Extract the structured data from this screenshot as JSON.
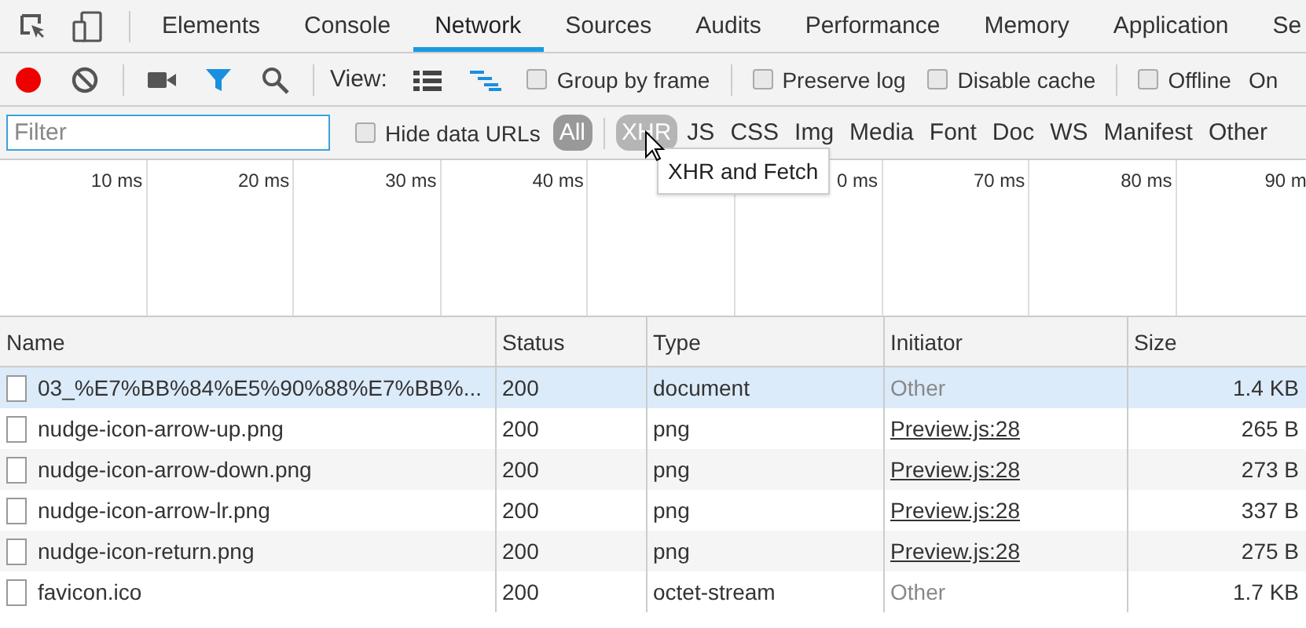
{
  "tabs": [
    {
      "label": "Elements",
      "selected": false
    },
    {
      "label": "Console",
      "selected": false
    },
    {
      "label": "Network",
      "selected": true
    },
    {
      "label": "Sources",
      "selected": false
    },
    {
      "label": "Audits",
      "selected": false
    },
    {
      "label": "Performance",
      "selected": false
    },
    {
      "label": "Memory",
      "selected": false
    },
    {
      "label": "Application",
      "selected": false
    },
    {
      "label": "Se",
      "selected": false
    }
  ],
  "toolbar": {
    "recording": true,
    "filter_active": true,
    "view_label": "View:",
    "checkboxes": [
      {
        "label": "Group by frame",
        "checked": false
      },
      {
        "label": "Preserve log",
        "checked": false
      },
      {
        "label": "Disable cache",
        "checked": false
      },
      {
        "label": "Offline",
        "checked": false
      }
    ],
    "trailing_text": "On"
  },
  "filter_bar": {
    "placeholder": "Filter",
    "hide_data_urls": {
      "label": "Hide data URLs",
      "checked": false
    },
    "types": [
      {
        "label": "All",
        "selected": true,
        "hovered": false
      },
      {
        "label": "XHR",
        "selected": false,
        "hovered": true
      },
      {
        "label": "JS",
        "selected": false,
        "hovered": false
      },
      {
        "label": "CSS",
        "selected": false,
        "hovered": false
      },
      {
        "label": "Img",
        "selected": false,
        "hovered": false
      },
      {
        "label": "Media",
        "selected": false,
        "hovered": false
      },
      {
        "label": "Font",
        "selected": false,
        "hovered": false
      },
      {
        "label": "Doc",
        "selected": false,
        "hovered": false
      },
      {
        "label": "WS",
        "selected": false,
        "hovered": false
      },
      {
        "label": "Manifest",
        "selected": false,
        "hovered": false
      },
      {
        "label": "Other",
        "selected": false,
        "hovered": false
      }
    ]
  },
  "tooltip": "XHR and Fetch",
  "overview": {
    "columns": [
      {
        "tick": "10 ms"
      },
      {
        "tick": "20 ms"
      },
      {
        "tick": "30 ms"
      },
      {
        "tick": "40 ms"
      },
      {},
      {
        "tick": "0 ms"
      },
      {
        "tick": "70 ms"
      },
      {
        "tick": "80 ms"
      },
      {
        "tick": "90 m"
      }
    ]
  },
  "table": {
    "columns": [
      "Name",
      "Status",
      "Type",
      "Initiator",
      "Size"
    ],
    "rows": [
      {
        "name": "03_%E7%BB%84%E5%90%88%E7%BB%...",
        "status": "200",
        "type": "document",
        "initiator": {
          "label": "Other",
          "kind": "text"
        },
        "size": "1.4 KB",
        "selected": true
      },
      {
        "name": "nudge-icon-arrow-up.png",
        "status": "200",
        "type": "png",
        "initiator": {
          "label": "Preview.js:28",
          "kind": "link"
        },
        "size": "265 B",
        "selected": false
      },
      {
        "name": "nudge-icon-arrow-down.png",
        "status": "200",
        "type": "png",
        "initiator": {
          "label": "Preview.js:28",
          "kind": "link"
        },
        "size": "273 B",
        "selected": false
      },
      {
        "name": "nudge-icon-arrow-lr.png",
        "status": "200",
        "type": "png",
        "initiator": {
          "label": "Preview.js:28",
          "kind": "link"
        },
        "size": "337 B",
        "selected": false
      },
      {
        "name": "nudge-icon-return.png",
        "status": "200",
        "type": "png",
        "initiator": {
          "label": "Preview.js:28",
          "kind": "link"
        },
        "size": "275 B",
        "selected": false
      },
      {
        "name": "favicon.ico",
        "status": "200",
        "type": "octet-stream",
        "initiator": {
          "label": "Other",
          "kind": "text"
        },
        "size": "1.7 KB",
        "selected": false
      }
    ]
  }
}
